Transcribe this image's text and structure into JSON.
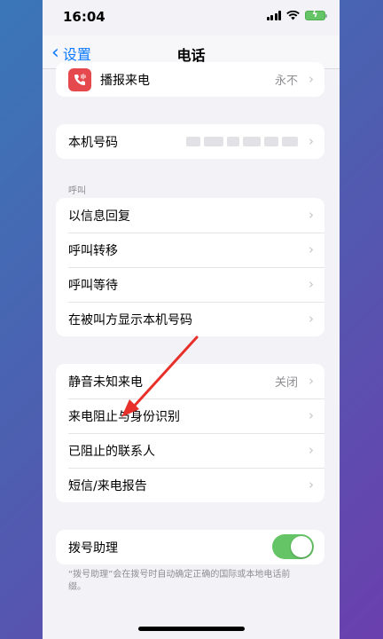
{
  "status_bar": {
    "time": "16:04"
  },
  "nav": {
    "back_label": "设置",
    "title": "电话"
  },
  "group_announce": {
    "rows": [
      {
        "label": "播报来电",
        "value": "永不"
      }
    ]
  },
  "group_number": {
    "rows": [
      {
        "label": "本机号码"
      }
    ]
  },
  "section_calls": {
    "header": "呼叫",
    "rows": [
      {
        "label": "以信息回复"
      },
      {
        "label": "呼叫转移"
      },
      {
        "label": "呼叫等待"
      },
      {
        "label": "在被叫方显示本机号码"
      }
    ]
  },
  "group_blocking": {
    "rows": [
      {
        "label": "静音未知来电",
        "value": "关闭"
      },
      {
        "label": "来电阻止与身份识别"
      },
      {
        "label": "已阻止的联系人"
      },
      {
        "label": "短信/来电报告"
      }
    ]
  },
  "group_dial_assist": {
    "label": "拨号助理",
    "toggle_on": true,
    "footer": "“拨号助理”会在拨号时自动确定正确的国际或本地电话前缀。"
  },
  "colors": {
    "accent": "#0a7aff",
    "toggle_on": "#65c466",
    "annotation_arrow": "#e8302a",
    "app_icon": "#e5484d"
  }
}
